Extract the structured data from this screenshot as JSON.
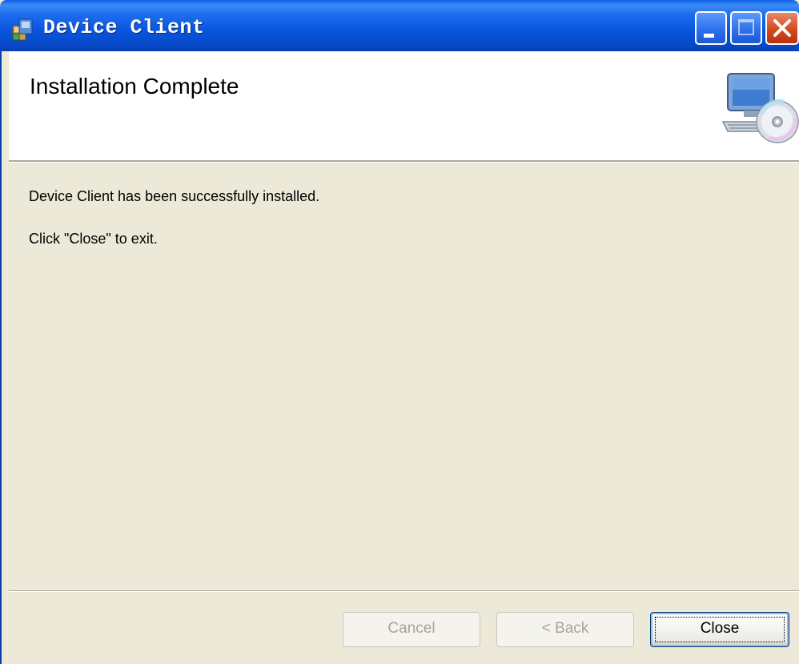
{
  "window": {
    "title": "Device Client",
    "icon": "installer-package-icon",
    "controls": [
      "minimize-icon",
      "maximize-icon",
      "close-icon"
    ]
  },
  "header": {
    "title": "Installation Complete",
    "icon": "computer-cd-setup-icon"
  },
  "body": {
    "message": "Device Client has been successfully installed.",
    "instruction": "Click \"Close\" to exit."
  },
  "buttons": {
    "cancel": {
      "label": "Cancel",
      "enabled": false
    },
    "back": {
      "label": "< Back",
      "accel": "B",
      "enabled": false
    },
    "close": {
      "label": "Close",
      "accel": "C",
      "enabled": true
    }
  },
  "colors": {
    "titlebar": "#0A5FE8",
    "dialog_background": "#ECE9D8",
    "close_button": "#D44A1E"
  }
}
